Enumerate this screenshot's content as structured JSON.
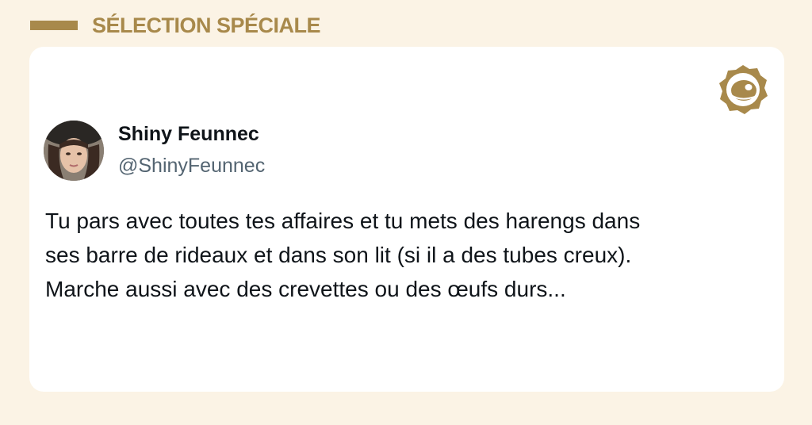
{
  "header": {
    "section_title": "SÉLECTION SPÉCIALE"
  },
  "tweet": {
    "author_name": "Shiny Feunnec",
    "author_handle": "@ShinyFeunnec",
    "text": "Tu pars avec toutes tes affaires et tu mets des harengs dans\nses barre de rideaux et dans son lit (si il a des tubes creux).\nMarche aussi avec des crevettes ou des œufs durs..."
  },
  "icons": {
    "brand": "brand-badge-icon",
    "avatar": "profile-photo"
  },
  "colors": {
    "background": "#fbf3e5",
    "accent_gold": "#a8894b",
    "card": "#ffffff",
    "name_text": "#0f1419",
    "handle_text": "#536471"
  }
}
